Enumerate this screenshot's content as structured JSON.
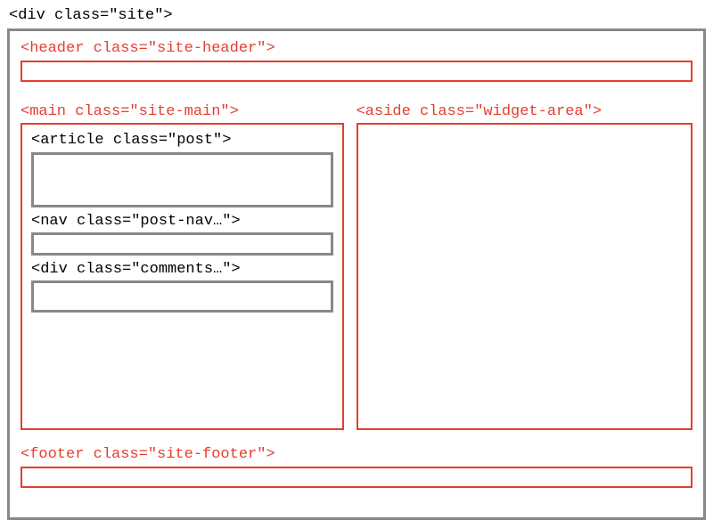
{
  "site": {
    "label": "<div class=\"site\">"
  },
  "header": {
    "label": "<header class=\"site-header\">"
  },
  "main": {
    "label": "<main class=\"site-main\">",
    "post": {
      "label": "<article class=\"post\">"
    },
    "postnav": {
      "label": "<nav class=\"post-nav…\">"
    },
    "comments": {
      "label": "<div class=\"comments…\">"
    }
  },
  "aside": {
    "label": "<aside class=\"widget-area\">"
  },
  "footer": {
    "label": "<footer class=\"site-footer\">"
  }
}
